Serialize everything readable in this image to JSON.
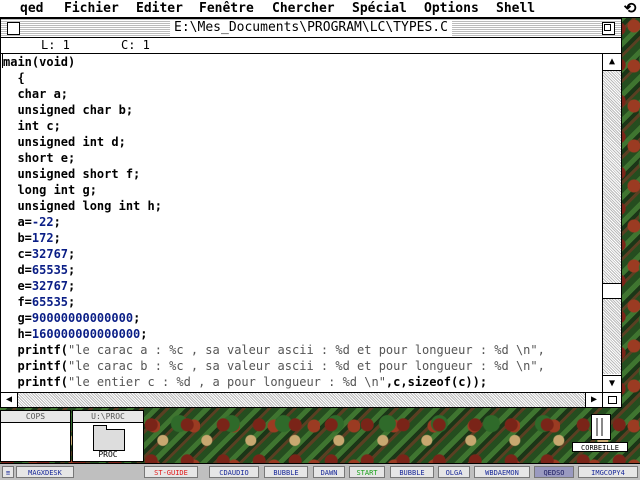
{
  "menubar": {
    "items": [
      "qed",
      "Fichier",
      "Editer",
      "Fenêtre",
      "Chercher",
      "Spécial",
      "Options",
      "Shell"
    ],
    "sync_icon": "sync-arrows-icon"
  },
  "editor": {
    "title": "E:\\Mes_Documents\\PROGRAM\\LC\\TYPES.C",
    "line_label": "L: 1",
    "col_label": "C: 1",
    "code_lines": [
      [
        [
          "plain",
          "main(void)"
        ]
      ],
      [
        [
          "plain",
          "  {"
        ]
      ],
      [
        [
          "plain",
          "  "
        ],
        [
          "kw",
          "char"
        ],
        [
          "plain",
          " a;"
        ]
      ],
      [
        [
          "plain",
          "  "
        ],
        [
          "kw",
          "unsigned char"
        ],
        [
          "plain",
          " b;"
        ]
      ],
      [
        [
          "plain",
          "  "
        ],
        [
          "kw",
          "int"
        ],
        [
          "plain",
          " c;"
        ]
      ],
      [
        [
          "plain",
          "  "
        ],
        [
          "kw",
          "unsigned int"
        ],
        [
          "plain",
          " d;"
        ]
      ],
      [
        [
          "plain",
          "  "
        ],
        [
          "kw",
          "short"
        ],
        [
          "plain",
          " e;"
        ]
      ],
      [
        [
          "plain",
          "  "
        ],
        [
          "kw",
          "unsigned short"
        ],
        [
          "plain",
          " f;"
        ]
      ],
      [
        [
          "plain",
          "  "
        ],
        [
          "kw",
          "long int"
        ],
        [
          "plain",
          " g;"
        ]
      ],
      [
        [
          "plain",
          "  "
        ],
        [
          "kw",
          "unsigned long int"
        ],
        [
          "plain",
          " h;"
        ]
      ],
      [
        [
          "plain",
          "  a="
        ],
        [
          "num",
          "-22"
        ],
        [
          "plain",
          ";"
        ]
      ],
      [
        [
          "plain",
          "  b="
        ],
        [
          "num",
          "172"
        ],
        [
          "plain",
          ";"
        ]
      ],
      [
        [
          "plain",
          "  c="
        ],
        [
          "num",
          "32767"
        ],
        [
          "plain",
          ";"
        ]
      ],
      [
        [
          "plain",
          "  d="
        ],
        [
          "num",
          "65535"
        ],
        [
          "plain",
          ";"
        ]
      ],
      [
        [
          "plain",
          "  e="
        ],
        [
          "num",
          "32767"
        ],
        [
          "plain",
          ";"
        ]
      ],
      [
        [
          "plain",
          "  f="
        ],
        [
          "num",
          "65535"
        ],
        [
          "plain",
          ";"
        ]
      ],
      [
        [
          "plain",
          "  g="
        ],
        [
          "num",
          "90000000000000"
        ],
        [
          "plain",
          ";"
        ]
      ],
      [
        [
          "plain",
          "  h="
        ],
        [
          "num",
          "160000000000000"
        ],
        [
          "plain",
          ";"
        ]
      ],
      [
        [
          "plain",
          "  printf("
        ],
        [
          "str",
          "\"le carac a : %c , sa valeur ascii : %d et pour longueur : %d \\n\","
        ]
      ],
      [
        [
          "plain",
          "  printf("
        ],
        [
          "str",
          "\"le carac b : %c , sa valeur ascii : %d et pour longueur : %d \\n\","
        ]
      ],
      [
        [
          "plain",
          "  printf("
        ],
        [
          "str",
          "\"le entier c : %d , a pour longueur : %d \\n\""
        ],
        [
          "plain",
          ",c,"
        ],
        [
          "kw",
          "sizeof"
        ],
        [
          "plain",
          "(c));"
        ]
      ]
    ],
    "vscroll_position": 0.74
  },
  "mini_windows": [
    {
      "title": "COPS"
    },
    {
      "title": "U:\\PROC",
      "folder_label": "PROC"
    }
  ],
  "trash": {
    "label": "CORBEILLE"
  },
  "taskbar": {
    "items": [
      {
        "label": "≡"
      },
      {
        "label": "MAGXDESK"
      },
      {
        "label": "ST-GUIDE"
      },
      {
        "label": "CDAUDIO"
      },
      {
        "label": "BUBBLE"
      },
      {
        "label": "DAWN"
      },
      {
        "label": "START"
      },
      {
        "label": "BUBBLE"
      },
      {
        "label": "OLGA"
      },
      {
        "label": "WBDAEMON"
      },
      {
        "label": "QEDSO"
      },
      {
        "label": "IMGCOPY4"
      }
    ],
    "colors": {
      "st_guide": "#e01818",
      "start": "#18a018",
      "default": "#1a2a9a",
      "selected": "#1a1a60"
    }
  }
}
